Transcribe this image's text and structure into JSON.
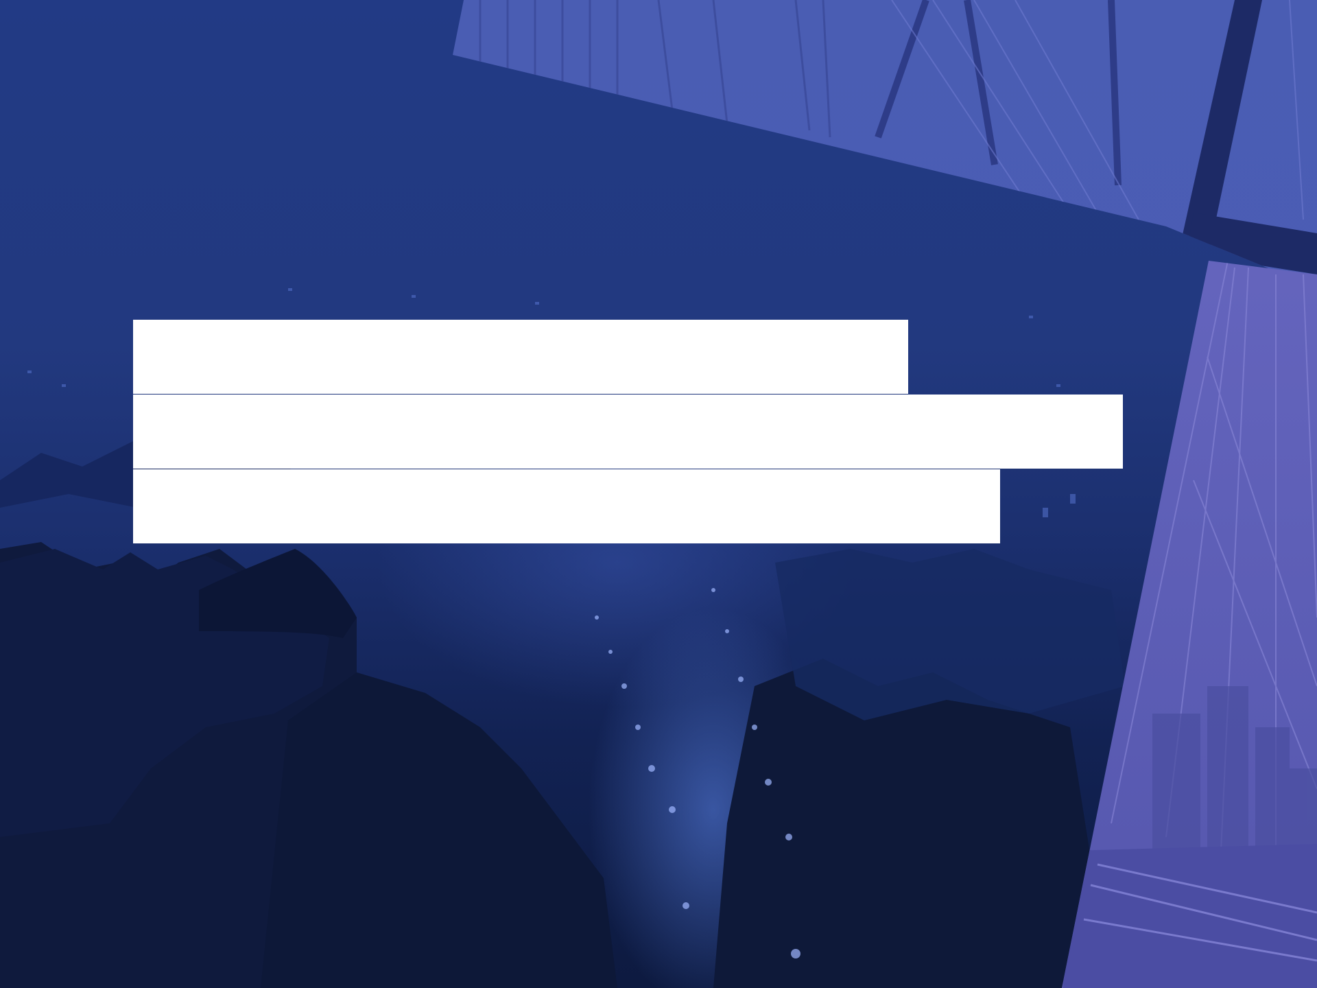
{
  "slide": {
    "title_lines": [
      "",
      "",
      ""
    ]
  },
  "colors": {
    "background_dark": "#0e1a45",
    "background_mid": "#22397f",
    "bridge_panel": "#4c5cb5",
    "bridge_panel_right": "#6a69c2",
    "bar_fill": "#ffffff"
  }
}
